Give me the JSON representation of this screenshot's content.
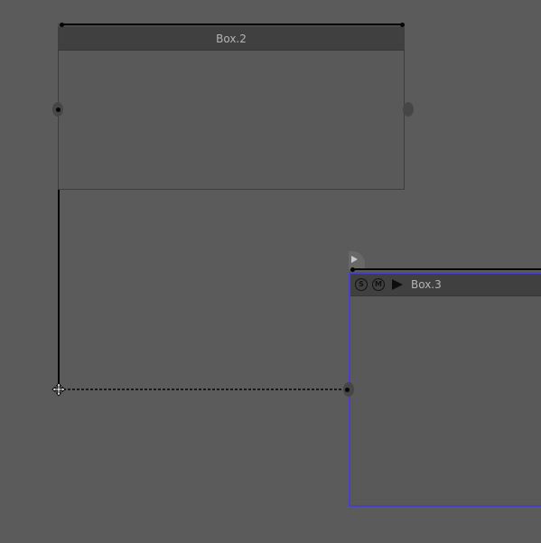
{
  "boxes": {
    "box2": {
      "title": "Box.2"
    },
    "box3": {
      "title": "Box.3",
      "solo_label": "S",
      "mute_label": "M"
    }
  },
  "colors": {
    "canvas": "#5b5b5b",
    "header": "#404040",
    "selection": "#4a40c8",
    "wire": "#050505"
  },
  "icons": {
    "play": "play-icon",
    "cursor": "move-cursor-icon",
    "tab_arrow": "expand-arrow-icon"
  }
}
